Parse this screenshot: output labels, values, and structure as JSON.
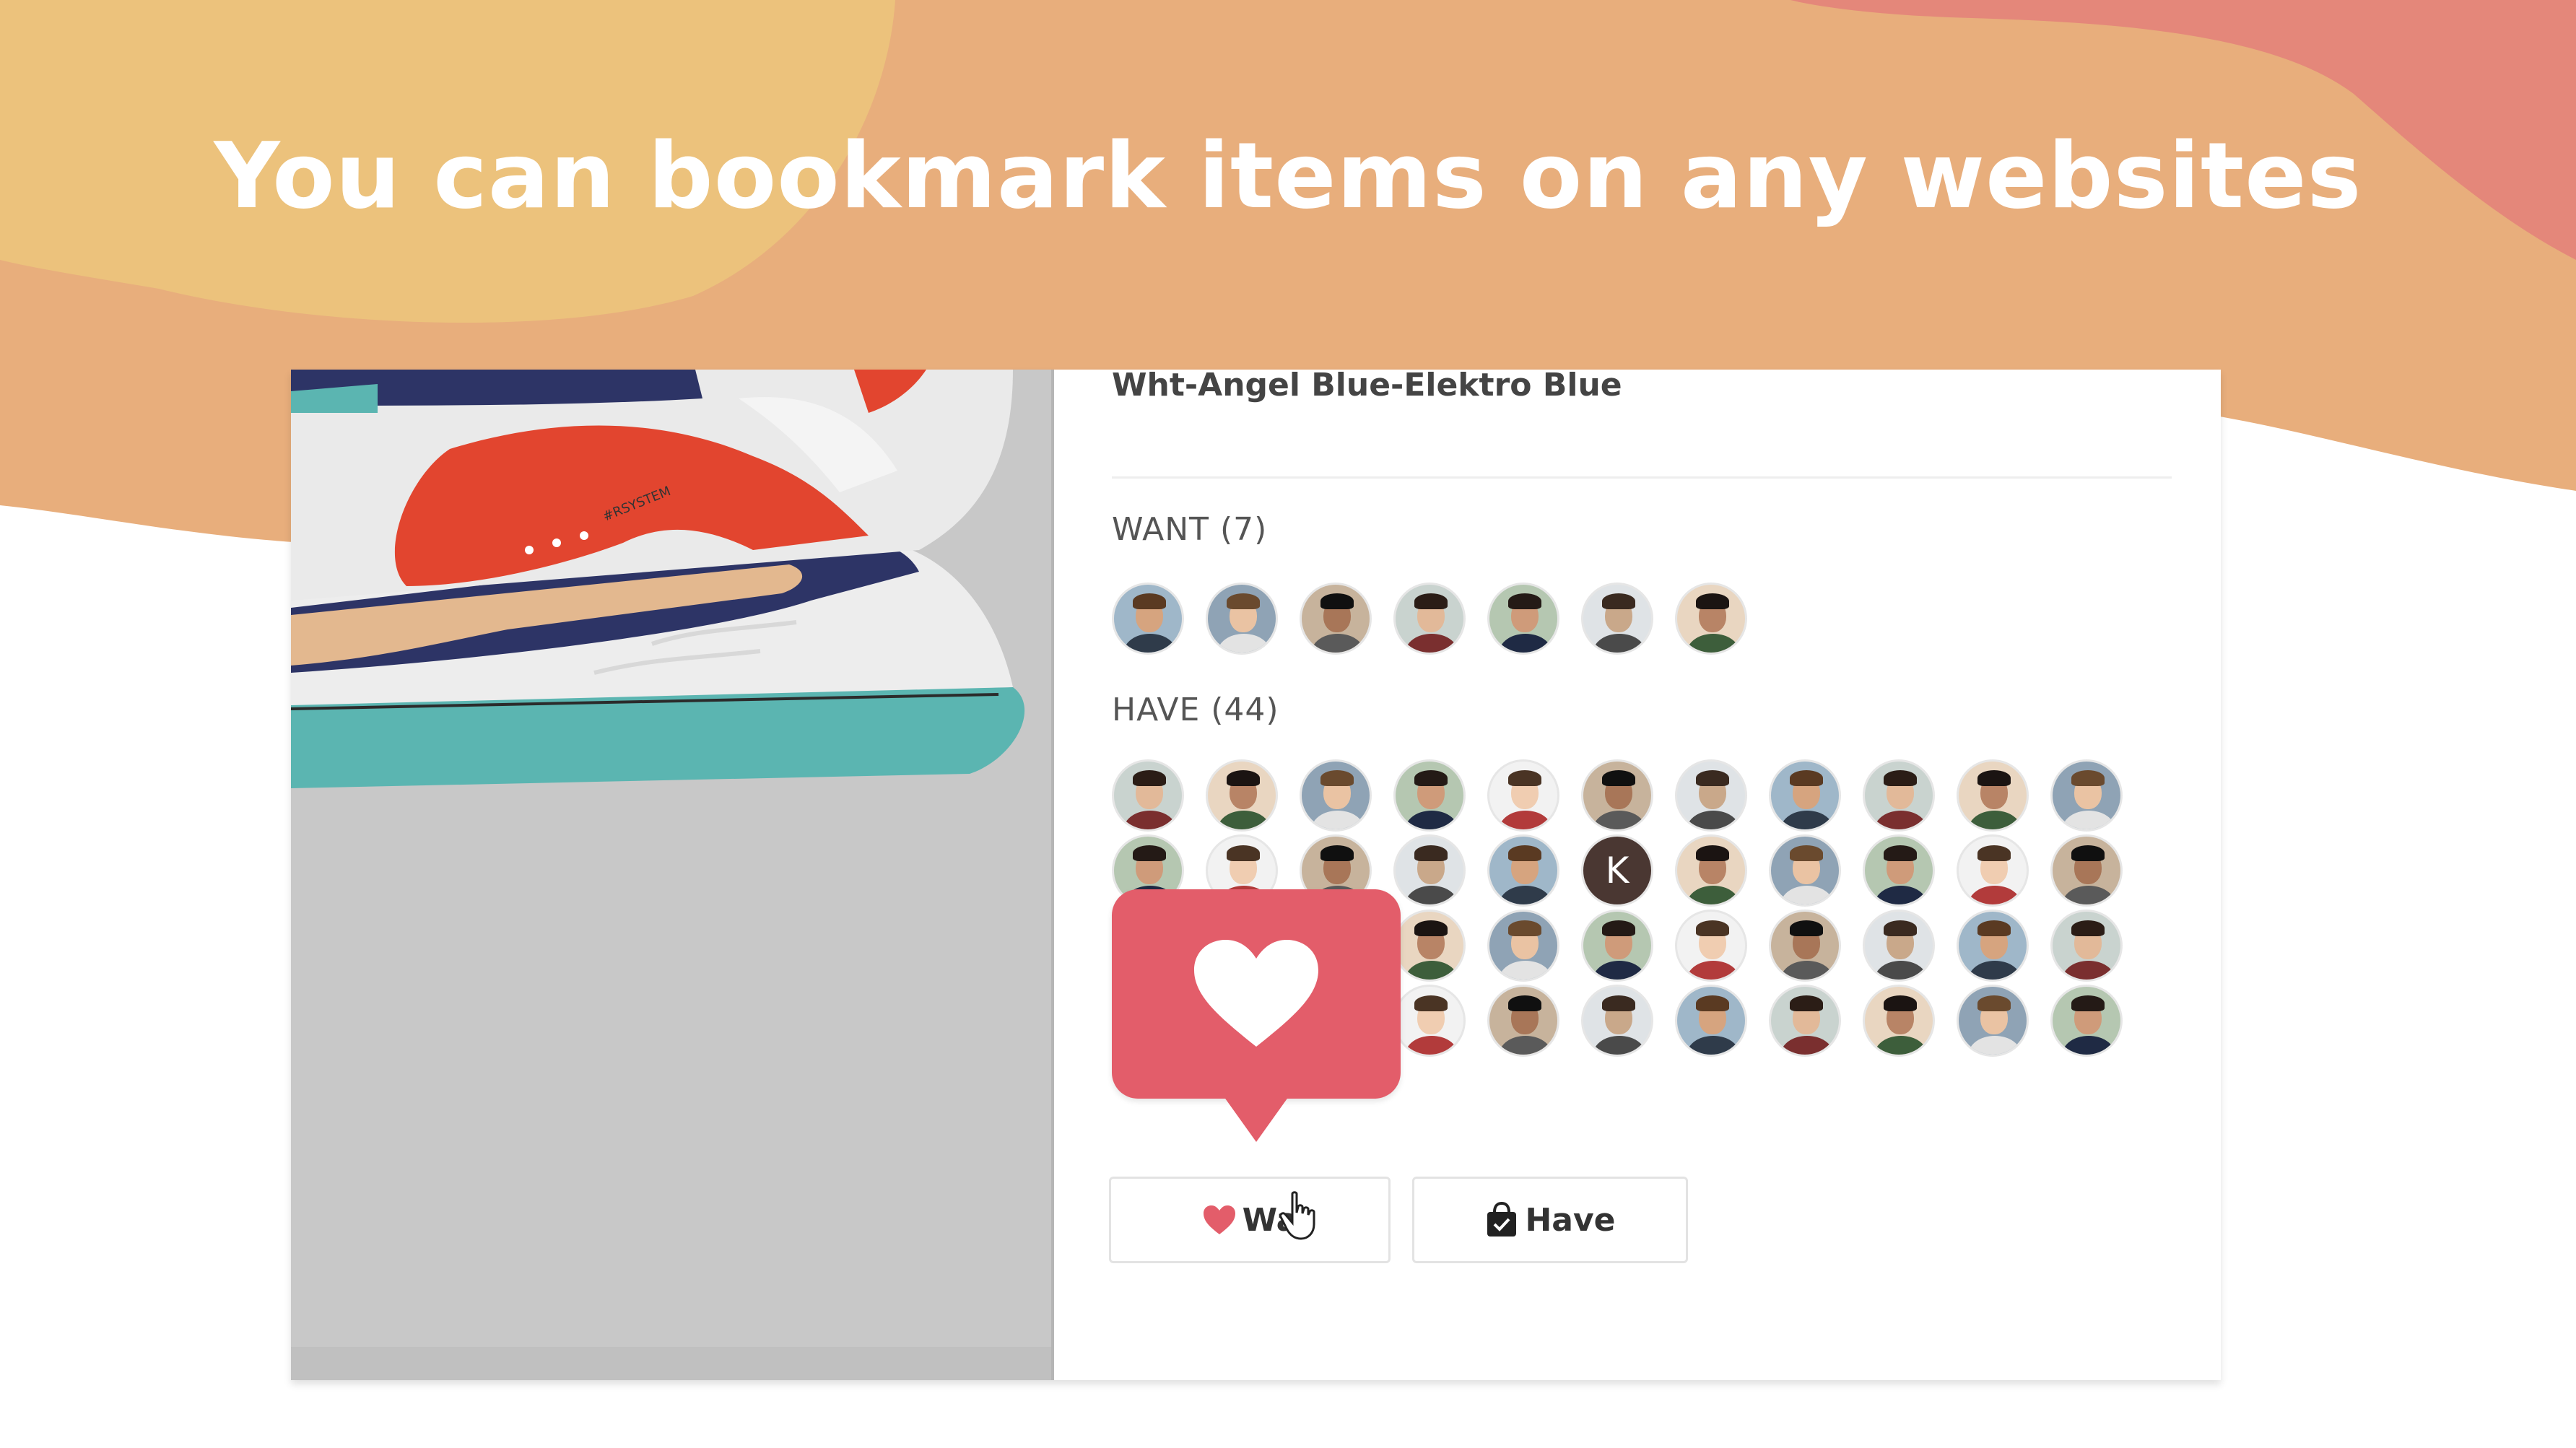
{
  "headline": "You can bookmark items on any websites",
  "product": {
    "variant": "Wht-Angel Blue-Elektro Blue",
    "shoe_print": "#RSYSTEM"
  },
  "want": {
    "label": "WANT (7)",
    "count": 7
  },
  "have": {
    "label": "HAVE (44)",
    "count": 44,
    "initial_avatar": "K"
  },
  "buttons": {
    "want_label": "Wa",
    "have_label": "Have",
    "want_icon": "heart-icon",
    "have_icon": "shopping-bag-check-icon"
  },
  "popup_icon": "heart-icon",
  "colors": {
    "brand_red": "#e35d6a",
    "blob_yellow": "#ebc07c",
    "blob_orange": "#e8ad7d",
    "blob_coral": "#e3857a"
  }
}
